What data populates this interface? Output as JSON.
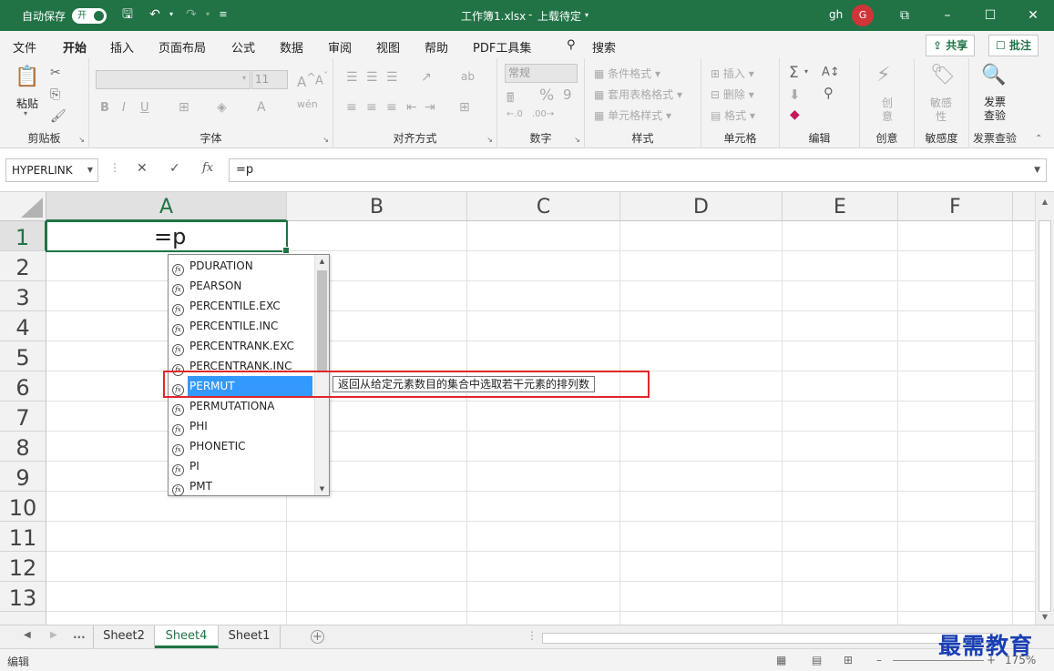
{
  "titlebar": {
    "autosave_label": "自动保存",
    "autosave_state": "开",
    "document_title": "工作簿1.xlsx",
    "upload_status": "上载待定",
    "user_initials": "gh",
    "avatar_letter": "G"
  },
  "menu": [
    "文件",
    "开始",
    "插入",
    "页面布局",
    "公式",
    "数据",
    "审阅",
    "视图",
    "帮助",
    "PDF工具集"
  ],
  "search_label": "搜索",
  "share_label": "共享",
  "comments_label": "批注",
  "ribbon": {
    "clipboard": {
      "paste": "粘贴",
      "group": "剪贴板"
    },
    "font": {
      "name": "",
      "size": "11",
      "group": "字体"
    },
    "alignment": {
      "group": "对齐方式"
    },
    "number": {
      "format": "常规",
      "group": "数字"
    },
    "styles": {
      "conditional": "条件格式",
      "table": "套用表格格式",
      "cell_styles": "单元格样式",
      "group": "样式"
    },
    "cells": {
      "insert": "插入",
      "delete": "删除",
      "format": "格式",
      "group": "单元格"
    },
    "editing": {
      "group": "编辑"
    },
    "creativity": {
      "label": "创意",
      "group": "创意"
    },
    "sensitivity": {
      "label": "敏感性",
      "group": "敏感度"
    },
    "invoice": {
      "label": "发票查验",
      "group": "发票查验"
    }
  },
  "formula_bar": {
    "name_box": "HYPERLINK",
    "formula": "=p",
    "fx": "fx"
  },
  "columns": [
    "A",
    "B",
    "C",
    "D",
    "E",
    "F"
  ],
  "rows": [
    "1",
    "2",
    "3",
    "4",
    "5",
    "6",
    "7",
    "8",
    "9",
    "10",
    "11",
    "12",
    "13"
  ],
  "active_cell": {
    "ref": "A1",
    "value": "=p"
  },
  "autocomplete": {
    "items": [
      "PDURATION",
      "PEARSON",
      "PERCENTILE.EXC",
      "PERCENTILE.INC",
      "PERCENTRANK.EXC",
      "PERCENTRANK.INC",
      "PERMUT",
      "PERMUTATIONA",
      "PHI",
      "PHONETIC",
      "PI",
      "PMT"
    ],
    "selected": "PERMUT",
    "tooltip": "返回从给定元素数目的集合中选取若干元素的排列数"
  },
  "sheets": {
    "ellipsis": "...",
    "tabs": [
      "Sheet2",
      "Sheet4",
      "Sheet1"
    ],
    "active": "Sheet4"
  },
  "status": {
    "mode": "编辑",
    "zoom": "175%"
  },
  "watermark": "最需教育",
  "colors": {
    "accent": "#217346",
    "highlight_box": "#e0262c",
    "selection": "#3399ff"
  }
}
